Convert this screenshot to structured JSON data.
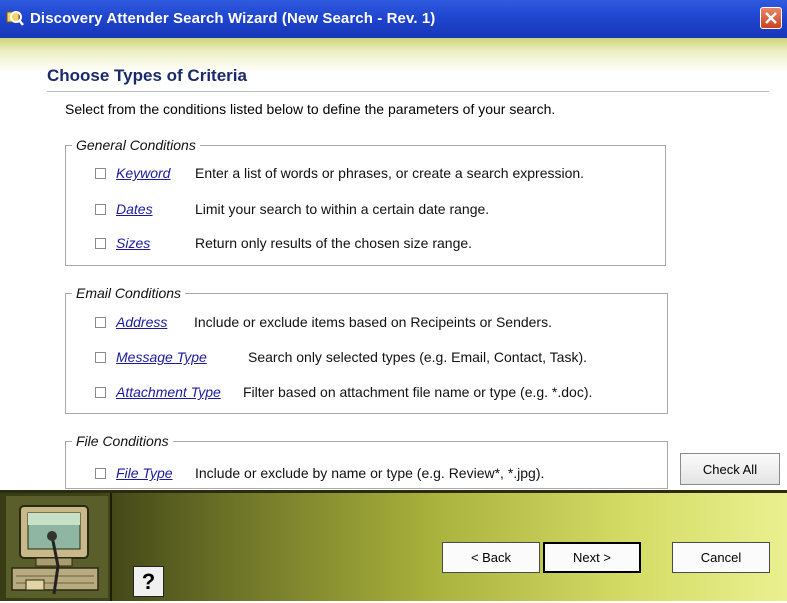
{
  "window": {
    "title": "Discovery Attender Search Wizard   (New Search - Rev. 1)"
  },
  "page": {
    "title": "Choose Types of Criteria",
    "instructions": "Select from the conditions listed below to define the parameters of your search."
  },
  "general": {
    "legend": "General Conditions",
    "items": [
      {
        "label": "Keyword",
        "desc": "Enter a list of words or phrases, or create a search expression.",
        "checked": false
      },
      {
        "label": "Dates",
        "desc": "Limit your search to within a certain date range.",
        "checked": false
      },
      {
        "label": "Sizes",
        "desc": "Return only results of the chosen size range.",
        "checked": false
      }
    ]
  },
  "email": {
    "legend": "Email Conditions",
    "items": [
      {
        "label": "Address",
        "desc": "Include or exclude items based on Recipeints or Senders.",
        "checked": false
      },
      {
        "label": "Message Type",
        "desc": "Search only selected types (e.g. Email, Contact, Task).",
        "checked": false
      },
      {
        "label": "Attachment Type",
        "desc": "Filter based on attachment file name or type (e.g. *.doc).",
        "checked": false
      }
    ]
  },
  "file": {
    "legend": "File Conditions",
    "items": [
      {
        "label": "File Type",
        "desc": "Include or exclude by name or type (e.g. Review*, *.jpg).",
        "checked": false
      }
    ]
  },
  "buttons": {
    "check_all": "Check All",
    "help": "?",
    "back": "< Back",
    "next": "Next >",
    "cancel": "Cancel"
  },
  "icons": {
    "app": "app-icon",
    "close": "close-icon",
    "wizard": "wizard-illustration-icon"
  },
  "colors": {
    "titlebar": "#1f45cf",
    "link": "#1a1aa0",
    "heading": "#1a2a6a",
    "close": "#c9421f"
  }
}
